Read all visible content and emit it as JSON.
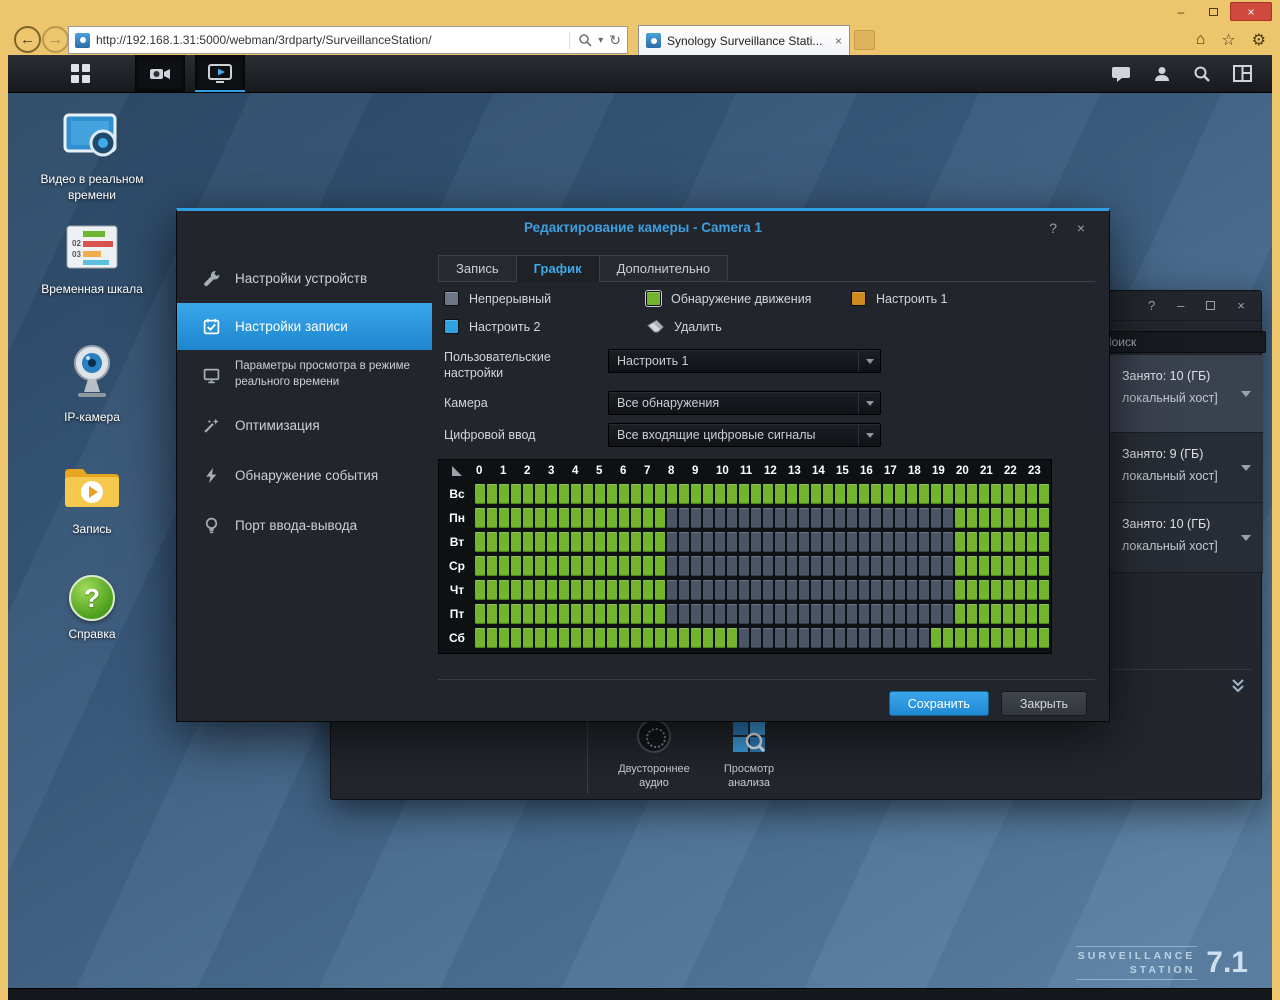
{
  "glyphs": {
    "back": "←",
    "forward": "→",
    "refresh": "↻",
    "caret": "▾",
    "home": "⌂",
    "star": "☆",
    "gear": "⚙",
    "minimize": "–",
    "close": "×",
    "help": "?"
  },
  "browser": {
    "url": "http://192.168.1.31:5000/webman/3rdparty/SurveillanceStation/",
    "tab_title": "Synology Surveillance Stati..."
  },
  "desktop": {
    "icons": [
      {
        "label": "Видео в реальном времени"
      },
      {
        "label": "Временная шкала",
        "num1": "02",
        "num2": "03"
      },
      {
        "label": "IP-камера"
      },
      {
        "label": "Запись"
      },
      {
        "label": "Справка",
        "glyph": "?"
      }
    ],
    "logo": {
      "line1": "SURVEILLANCE",
      "line2": "STATION",
      "version": "7.1"
    }
  },
  "bg_window": {
    "search_text": "Поиск",
    "rows": [
      {
        "line1": "Занято: 10 (ГБ)",
        "line2": "локальный хост]"
      },
      {
        "line1": "Занято: 9 (ГБ)",
        "line2": "локальный хост]"
      },
      {
        "line1": "Занято: 10 (ГБ)",
        "line2": "локальный хост]"
      }
    ],
    "tools": [
      {
        "label": "Двустороннее аудио"
      },
      {
        "label": "Просмотр анализа"
      }
    ]
  },
  "dialog": {
    "title": "Редактирование камеры - Camera 1",
    "nav": [
      {
        "label": "Настройки устройств",
        "selected": false
      },
      {
        "label": "Настройки записи",
        "selected": true
      },
      {
        "label": "Параметры просмотра в режиме реального времени",
        "selected": false
      },
      {
        "label": "Оптимизация",
        "selected": false
      },
      {
        "label": "Обнаружение события",
        "selected": false
      },
      {
        "label": "Порт ввода-вывода",
        "selected": false
      }
    ],
    "tabs": [
      {
        "label": "Запись",
        "selected": false
      },
      {
        "label": "График",
        "selected": true
      },
      {
        "label": "Дополнительно",
        "selected": false
      }
    ],
    "legend": {
      "continuous": {
        "label": "Непрерывный",
        "color": "#6c7686"
      },
      "motion": {
        "label": "Обнаружение движения",
        "color": "#72b52d"
      },
      "custom1": {
        "label": "Настроить 1",
        "color": "#d08b1d"
      },
      "custom2": {
        "label": "Настроить 2",
        "color": "#2fa3e2"
      },
      "erase": {
        "label": "Удалить"
      }
    },
    "form": {
      "custom_settings": {
        "label": "Пользовательские настройки",
        "value": "Настроить 1"
      },
      "camera": {
        "label": "Камера",
        "value": "Все обнаружения"
      },
      "digital_input": {
        "label": "Цифровой ввод",
        "value": "Все входящие цифровые сигналы"
      }
    },
    "schedule": {
      "hours": [
        "0",
        "1",
        "2",
        "3",
        "4",
        "5",
        "6",
        "7",
        "8",
        "9",
        "10",
        "11",
        "12",
        "13",
        "14",
        "15",
        "16",
        "17",
        "18",
        "19",
        "20",
        "21",
        "22",
        "23"
      ],
      "days": [
        {
          "label": "Вс",
          "active": [
            [
              0,
              24
            ]
          ]
        },
        {
          "label": "Пн",
          "active": [
            [
              0,
              8
            ],
            [
              20,
              24
            ]
          ]
        },
        {
          "label": "Вт",
          "active": [
            [
              0,
              8
            ],
            [
              20,
              24
            ]
          ]
        },
        {
          "label": "Ср",
          "active": [
            [
              0,
              8
            ],
            [
              20,
              24
            ]
          ]
        },
        {
          "label": "Чт",
          "active": [
            [
              0,
              8
            ],
            [
              20,
              24
            ]
          ]
        },
        {
          "label": "Пт",
          "active": [
            [
              0,
              8
            ],
            [
              20,
              24
            ]
          ]
        },
        {
          "label": "Сб",
          "active": [
            [
              0,
              11
            ],
            [
              19,
              24
            ]
          ]
        }
      ],
      "colors": {
        "active": "#72b52d",
        "inactive": "#4c5565"
      }
    },
    "buttons": {
      "save": "Сохранить",
      "close": "Закрыть"
    }
  }
}
